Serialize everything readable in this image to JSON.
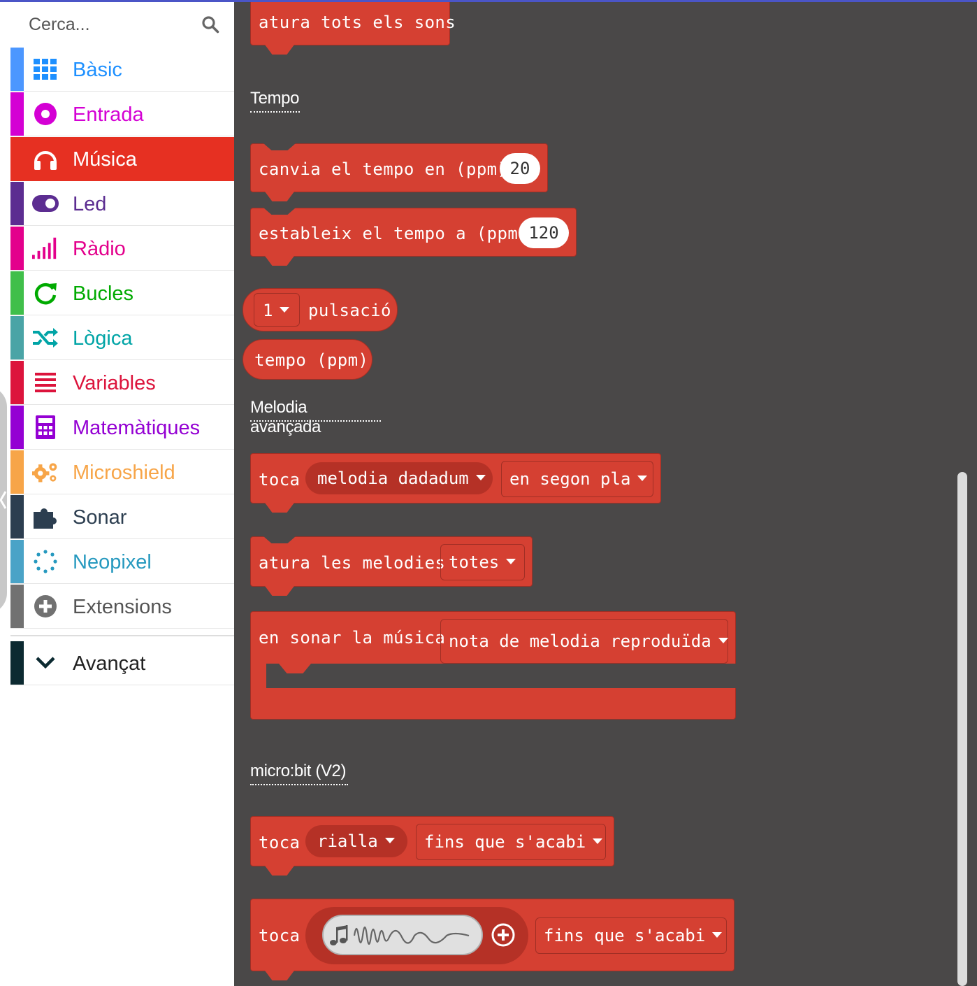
{
  "search": {
    "placeholder": "Cerca..."
  },
  "categories": [
    {
      "label": "Bàsic",
      "color": "#1e90ff",
      "icon": "grid-icon"
    },
    {
      "label": "Entrada",
      "color": "#d400d4",
      "icon": "target-icon"
    },
    {
      "label": "Música",
      "color": "#e63022",
      "icon": "headphones-icon",
      "selected": true
    },
    {
      "label": "Led",
      "color": "#5c2d91",
      "icon": "toggle-icon"
    },
    {
      "label": "Ràdio",
      "color": "#e3008c",
      "icon": "signal-bars-icon"
    },
    {
      "label": "Bucles",
      "color": "#00aa00",
      "icon": "refresh-icon"
    },
    {
      "label": "Lògica",
      "color": "#00a4a6",
      "icon": "shuffle-icon"
    },
    {
      "label": "Variables",
      "color": "#dc143c",
      "icon": "list-icon"
    },
    {
      "label": "Matemàtiques",
      "color": "#9400d3",
      "icon": "calculator-icon"
    },
    {
      "label": "Microshield",
      "color": "#f7a548",
      "icon": "gears-icon"
    },
    {
      "label": "Sonar",
      "color": "#2c3e50",
      "icon": "puzzle-icon"
    },
    {
      "label": "Neopixel",
      "color": "#2699bf",
      "icon": "dots-circle-icon"
    },
    {
      "label": "Extensions",
      "color": "#717171",
      "icon": "plus-circle-icon"
    }
  ],
  "advanced": {
    "label": "Avançat",
    "color": "#0c2a31"
  },
  "flyout": {
    "block_stop_all": "atura tots els sons",
    "heading_tempo": "Tempo",
    "block_change_tempo": {
      "text": "canvia el tempo en (ppm)",
      "value": "20"
    },
    "block_set_tempo": {
      "text": "estableix el tempo a (ppm)",
      "value": "120"
    },
    "block_beat": {
      "value": "1",
      "text": "pulsació"
    },
    "block_tempo_reporter": "tempo (ppm)",
    "heading_advanced_melody": "Melodia avançada",
    "block_play_melody": {
      "verb": "toca",
      "melody": "melodia dadadum",
      "mode": "en segon pla"
    },
    "block_stop_melodies": {
      "text": "atura les melodies",
      "option": "totes"
    },
    "block_on_music": {
      "text": "en sonar la música",
      "option": "nota de melodia reproduïda"
    },
    "heading_v2": "micro:bit (V2)",
    "block_play_sound": {
      "verb": "toca",
      "sound": "rialla",
      "mode": "fins que s'acabi"
    },
    "block_play_custom": {
      "verb": "toca",
      "mode": "fins que s'acabi"
    }
  }
}
